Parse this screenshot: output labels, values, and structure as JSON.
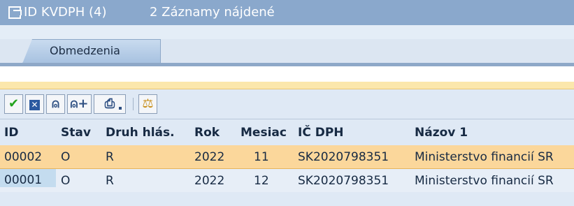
{
  "title": {
    "name": "ID KVDPH (4)",
    "count": "2 Záznamy nájdené"
  },
  "tabs": [
    {
      "label": "Obmedzenia"
    }
  ],
  "toolbar": {
    "buttons": [
      {
        "name": "continue",
        "icon": "checkmark-icon"
      },
      {
        "name": "cancel",
        "icon": "cancel-x-icon"
      },
      {
        "name": "find",
        "icon": "binoculars-icon"
      },
      {
        "name": "find-next",
        "icon": "binoculars-plus-icon"
      },
      {
        "name": "print",
        "icon": "printer-icon"
      },
      {
        "name": "sort",
        "icon": "sort-icon"
      }
    ]
  },
  "table": {
    "columns": [
      "ID",
      "Stav",
      "Druh hlás.",
      "Rok",
      "Mesiac",
      "IČ DPH",
      "Názov 1"
    ],
    "rows": [
      {
        "id": "00002",
        "stav": "O",
        "druh": "R",
        "rok": "2022",
        "mesiac": "11",
        "icdph": "SK2020798351",
        "nazov": "Ministerstvo financií SR",
        "selected": true
      },
      {
        "id": "00001",
        "stav": "O",
        "druh": "R",
        "rok": "2022",
        "mesiac": "12",
        "icdph": "SK2020798351",
        "nazov": "Ministerstvo financií SR",
        "selected": false
      }
    ]
  },
  "colors": {
    "title_bar": "#8aa8cc",
    "selected_row": "#fbd79b",
    "highlight_bar": "#fbe7ac"
  }
}
